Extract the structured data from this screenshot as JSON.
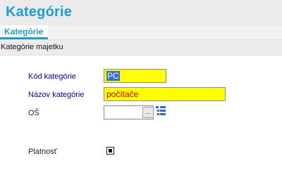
{
  "page": {
    "title": "Kategórie"
  },
  "tabs": [
    {
      "label": "Kategórie",
      "active": true
    }
  ],
  "section": {
    "title": "Kategórie majetku"
  },
  "form": {
    "kod": {
      "label": "Kód kategórie",
      "value": "PC",
      "required": true
    },
    "nazov": {
      "label": "Názov kategórie",
      "value": "počítače",
      "required": true
    },
    "os": {
      "label": "OŠ",
      "value": "",
      "browse_label": "..."
    },
    "platnost": {
      "label": "Platnosť",
      "checked": true
    }
  },
  "colors": {
    "accent": "#1e9bd7",
    "required_field": "#ffff00",
    "required_label": "#0000cc"
  },
  "icons": {
    "browse": "ellipsis-icon",
    "tree": "tree-list-icon",
    "checkbox": "checkbox-checked-icon"
  }
}
